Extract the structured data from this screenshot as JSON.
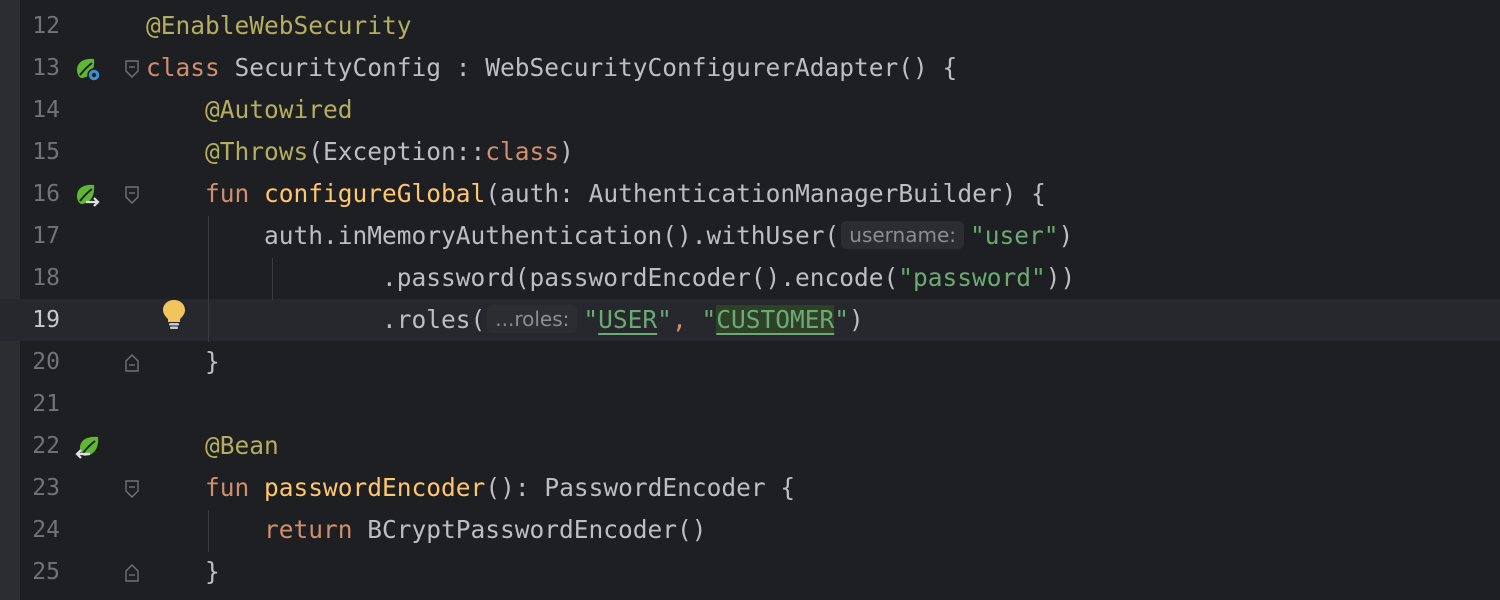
{
  "editor": {
    "lines": [
      {
        "num": "12",
        "segs": [
          {
            "t": "@EnableWebSecurity",
            "c": "ann"
          }
        ]
      },
      {
        "num": "13",
        "segs": [
          {
            "t": "class",
            "c": "kw"
          },
          {
            "t": " SecurityConfig : WebSecurityConfigurerAdapter() {",
            "c": "plain"
          }
        ]
      },
      {
        "num": "14",
        "segs": [
          {
            "t": "    ",
            "c": "plain"
          },
          {
            "t": "@Autowired",
            "c": "ann"
          }
        ]
      },
      {
        "num": "15",
        "segs": [
          {
            "t": "    ",
            "c": "plain"
          },
          {
            "t": "@Throws",
            "c": "ann"
          },
          {
            "t": "(Exception::",
            "c": "plain"
          },
          {
            "t": "class",
            "c": "kw"
          },
          {
            "t": ")",
            "c": "plain"
          }
        ]
      },
      {
        "num": "16",
        "segs": [
          {
            "t": "    ",
            "c": "plain"
          },
          {
            "t": "fun",
            "c": "kw"
          },
          {
            "t": " ",
            "c": "plain"
          },
          {
            "t": "configureGlobal",
            "c": "fnd"
          },
          {
            "t": "(auth: AuthenticationManagerBuilder) {",
            "c": "plain"
          }
        ]
      },
      {
        "num": "17",
        "segs": [
          {
            "t": "        auth.inMemoryAuthentication().withUser(",
            "c": "plain"
          },
          {
            "t": "username:",
            "c": "hint"
          },
          {
            "t": "\"user\"",
            "c": "str"
          },
          {
            "t": ")",
            "c": "plain"
          }
        ]
      },
      {
        "num": "18",
        "segs": [
          {
            "t": "                .password(passwordEncoder().encode(",
            "c": "plain"
          },
          {
            "t": "\"password\"",
            "c": "str"
          },
          {
            "t": "))",
            "c": "plain"
          }
        ]
      },
      {
        "num": "19",
        "segs": [
          {
            "t": "                .roles(",
            "c": "plain"
          },
          {
            "t": "...roles:",
            "c": "hint"
          },
          {
            "t": "\"",
            "c": "str"
          },
          {
            "t": "USER",
            "c": "str ul"
          },
          {
            "t": "\"",
            "c": "str"
          },
          {
            "t": ", ",
            "c": "kw"
          },
          {
            "t": "\"",
            "c": "str"
          },
          {
            "t": "CUSTOMER",
            "c": "str ul hl"
          },
          {
            "t": "\"",
            "c": "str"
          },
          {
            "t": ")",
            "c": "plain"
          }
        ]
      },
      {
        "num": "20",
        "segs": [
          {
            "t": "    }",
            "c": "plain"
          }
        ]
      },
      {
        "num": "21",
        "segs": []
      },
      {
        "num": "22",
        "segs": [
          {
            "t": "    ",
            "c": "plain"
          },
          {
            "t": "@Bean",
            "c": "ann"
          }
        ]
      },
      {
        "num": "23",
        "segs": [
          {
            "t": "    ",
            "c": "plain"
          },
          {
            "t": "fun",
            "c": "kw"
          },
          {
            "t": " ",
            "c": "plain"
          },
          {
            "t": "passwordEncoder",
            "c": "fnd"
          },
          {
            "t": "(): PasswordEncoder {",
            "c": "plain"
          }
        ]
      },
      {
        "num": "24",
        "segs": [
          {
            "t": "        ",
            "c": "plain"
          },
          {
            "t": "return",
            "c": "kw"
          },
          {
            "t": " BCryptPasswordEncoder()",
            "c": "plain"
          }
        ]
      },
      {
        "num": "25",
        "segs": [
          {
            "t": "    }",
            "c": "plain"
          }
        ]
      }
    ]
  },
  "gutter_icons": [
    {
      "line": "13",
      "icon": "spring-bean-config-icon"
    },
    {
      "line": "16",
      "icon": "spring-autowired-navigate-icon"
    },
    {
      "line": "22",
      "icon": "spring-bean-navigate-icon"
    }
  ],
  "intention": {
    "line": "19",
    "icon": "lightbulb-icon"
  },
  "colors": {
    "background": "#1e1f22",
    "keyword": "#cf8e6d",
    "annotation": "#b3ae60",
    "function_decl": "#ffc66d",
    "string": "#6aab73",
    "text": "#bcbec4",
    "line_number": "#6f737a",
    "current_line": "#26282e",
    "spring_icon": "#5fb832",
    "bulb": "#f2c55c"
  }
}
